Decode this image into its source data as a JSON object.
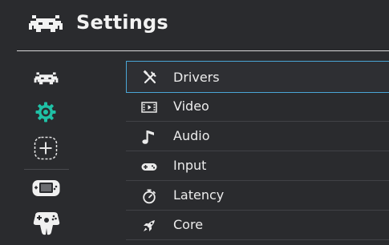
{
  "header": {
    "title": "Settings",
    "logo_icon": "retroarch-invader-icon"
  },
  "sidebar": {
    "items": [
      {
        "icon": "retroarch-invader-icon",
        "selected": false
      },
      {
        "icon": "gear-icon",
        "selected": true,
        "color": "#1fc1a6"
      },
      {
        "icon": "add-icon",
        "selected": false
      },
      {
        "icon": "handheld-console-icon",
        "selected": false
      },
      {
        "icon": "gamepad-n64-icon",
        "selected": false
      }
    ]
  },
  "menu": {
    "items": [
      {
        "label": "Drivers",
        "icon": "tools-icon",
        "selected": true
      },
      {
        "label": "Video",
        "icon": "film-icon",
        "selected": false
      },
      {
        "label": "Audio",
        "icon": "music-note-icon",
        "selected": false
      },
      {
        "label": "Input",
        "icon": "gamepad-icon",
        "selected": false
      },
      {
        "label": "Latency",
        "icon": "stopwatch-icon",
        "selected": false
      },
      {
        "label": "Core",
        "icon": "rocket-icon",
        "selected": false
      }
    ]
  },
  "colors": {
    "background": "#2a2b2e",
    "accent": "#4aa6d6",
    "selected_sidebar": "#1fc1a6"
  }
}
